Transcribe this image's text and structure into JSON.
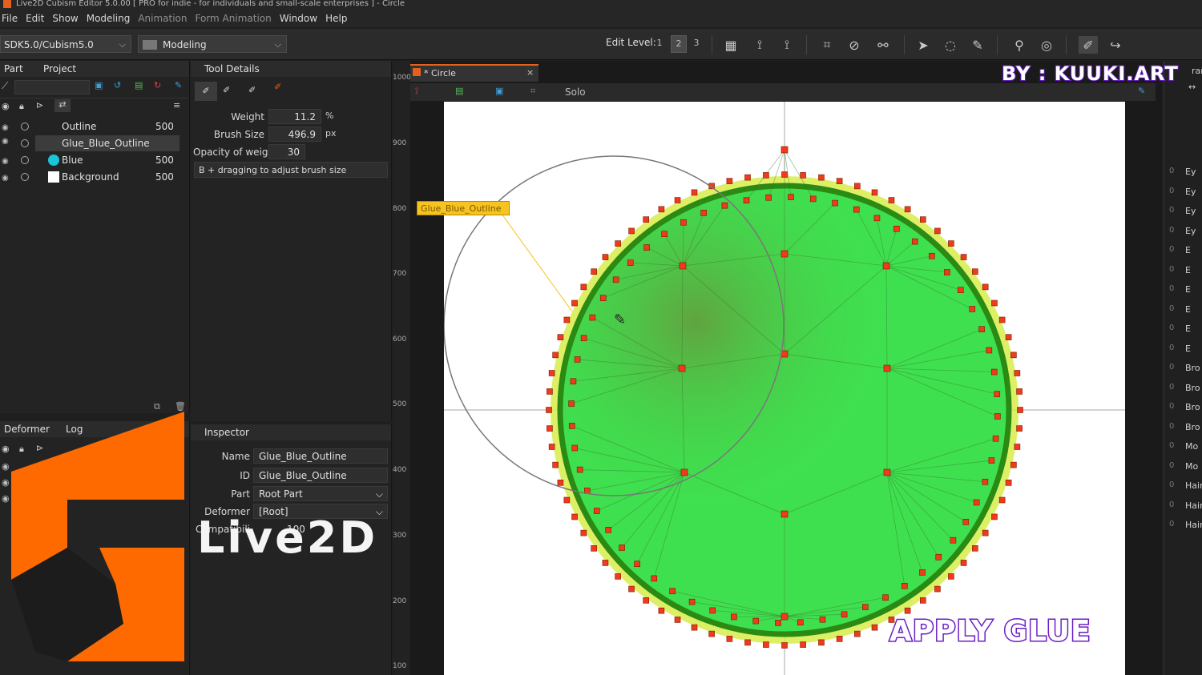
{
  "window": {
    "title": "Live2D Cubism Editor 5.0.00   [ PRO for indie - for individuals and small-scale enterprises ]  - Circle"
  },
  "menu": [
    "File",
    "Edit",
    "Show",
    "Modeling",
    "Animation",
    "Form Animation",
    "Window",
    "Help"
  ],
  "toolbar": {
    "sdk_select": "SDK5.0/Cubism5.0",
    "mode_select": "Modeling",
    "edit_level_label": "Edit Level:",
    "edit_levels": [
      "1",
      "2",
      "3"
    ],
    "selected_edit_level": "2"
  },
  "part_panel": {
    "tabs": [
      "Part",
      "Project"
    ],
    "layers": [
      {
        "name": "Outline",
        "value": "500"
      },
      {
        "name": "Glue_Blue_Outline",
        "value": ""
      },
      {
        "name": "Blue",
        "value": "500"
      },
      {
        "name": "Background",
        "value": "500"
      }
    ],
    "blue_color": "#19c6d8"
  },
  "tool_details": {
    "title": "Tool Details",
    "weight_label": "Weight",
    "weight_value": "11.2",
    "weight_unit": "%",
    "brush_label": "Brush Size",
    "brush_value": "496.9",
    "brush_unit": "px",
    "opacity_label": "Opacity of weight",
    "opacity_value": "30",
    "hint": "B + dragging to adjust brush size"
  },
  "deformer_panel": {
    "tabs": [
      "Deformer",
      "Log"
    ]
  },
  "inspector": {
    "title": "Inspector",
    "name_label": "Name",
    "name_value": "Glue_Blue_Outline",
    "id_label": "ID",
    "id_value": "Glue_Blue_Outline",
    "part_label": "Part",
    "part_value": "Root Part",
    "deformer_label": "Deformer",
    "deformer_value": "[Root]",
    "compat_label": "Compatibili",
    "compat_value": "100"
  },
  "document": {
    "tab_label": "* Circle",
    "solo_label": "Solo",
    "glue_tag": "Glue_Blue_Outline"
  },
  "ruler_ticks": [
    "1000",
    "900",
    "800",
    "700",
    "600",
    "500",
    "400",
    "300",
    "200",
    "100"
  ],
  "right_params": [
    "Ey",
    "Ey",
    "Ey",
    "Ey",
    "E",
    "E",
    "E",
    "E",
    "E",
    "E",
    "Bro",
    "Bro",
    "Bro",
    "Bro",
    "Mo",
    "Mo",
    "Hair",
    "Hair",
    "Hair"
  ],
  "right_header": "ram",
  "overlays": {
    "brand": "BY : KUUKI.ART",
    "caption": "APPLY GLUE",
    "logo_text": "Live2D"
  },
  "colors": {
    "accent": "#e4601f",
    "mesh_fill": "#3fe04f",
    "mesh_ring": "#2a8a14",
    "mesh_halo": "#d6ec4a",
    "vertex": "#f03a1c",
    "brand_stroke": "#6a1fc7"
  }
}
